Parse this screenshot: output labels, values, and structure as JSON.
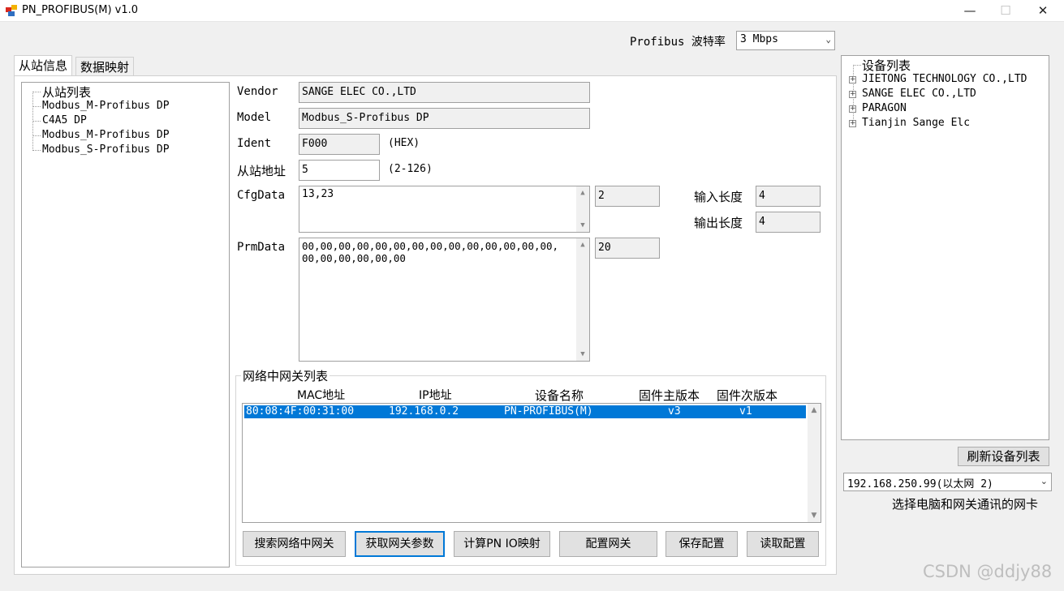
{
  "window": {
    "title": "PN_PROFIBUS(M) v1.0",
    "min": "—",
    "max": "☐",
    "close": "✕"
  },
  "baud": {
    "label": "Profibus 波特率",
    "value": "3 Mbps"
  },
  "tabs": [
    {
      "label": "从站信息"
    },
    {
      "label": "数据映射"
    }
  ],
  "slave_tree": {
    "root": "从站列表",
    "items": [
      "Modbus_M-Profibus DP",
      "C4A5 DP",
      "Modbus_M-Profibus DP",
      "Modbus_S-Profibus DP"
    ]
  },
  "form": {
    "vendor_label": "Vendor",
    "vendor_value": "SANGE ELEC CO.,LTD",
    "model_label": "Model",
    "model_value": "Modbus_S-Profibus DP",
    "ident_label": "Ident",
    "ident_value": "F000",
    "ident_hint": "(HEX)",
    "addr_label": "从站地址",
    "addr_value": "5",
    "addr_hint": "(2-126)",
    "cfg_label": "CfgData",
    "cfg_value": "13,23",
    "cfg_count": "2",
    "input_len_label": "输入长度",
    "input_len_value": "4",
    "output_len_label": "输出长度",
    "output_len_value": "4",
    "prm_label": "PrmData",
    "prm_line1": "00,00,00,00,00,00,00,00,00,00,00,00,00,00,",
    "prm_line2": "00,00,00,00,00,00",
    "prm_count": "20"
  },
  "gateway": {
    "group_label": "网络中网关列表",
    "columns": [
      "MAC地址",
      "IP地址",
      "设备名称",
      "固件主版本",
      "固件次版本"
    ],
    "rows": [
      {
        "mac": "80:08:4F:00:31:00",
        "ip": "192.168.0.2",
        "name": "PN-PROFIBUS(M)",
        "major": "v3",
        "minor": "v1"
      }
    ]
  },
  "buttons": {
    "search": "搜索网络中网关",
    "get_params": "获取网关参数",
    "calc_map": "计算PN IO映射",
    "config": "配置网关",
    "save": "保存配置",
    "read": "读取配置"
  },
  "device_tree": {
    "root": "设备列表",
    "items": [
      "JIETONG TECHNOLOGY CO.,LTD",
      "SANGE ELEC CO.,LTD",
      "PARAGON",
      "Tianjin Sange Elc"
    ]
  },
  "refresh_button": "刷新设备列表",
  "nic": {
    "value": "192.168.250.99(以太网 2)",
    "hint": "选择电脑和网关通讯的网卡"
  },
  "watermark": "CSDN @ddjy88"
}
